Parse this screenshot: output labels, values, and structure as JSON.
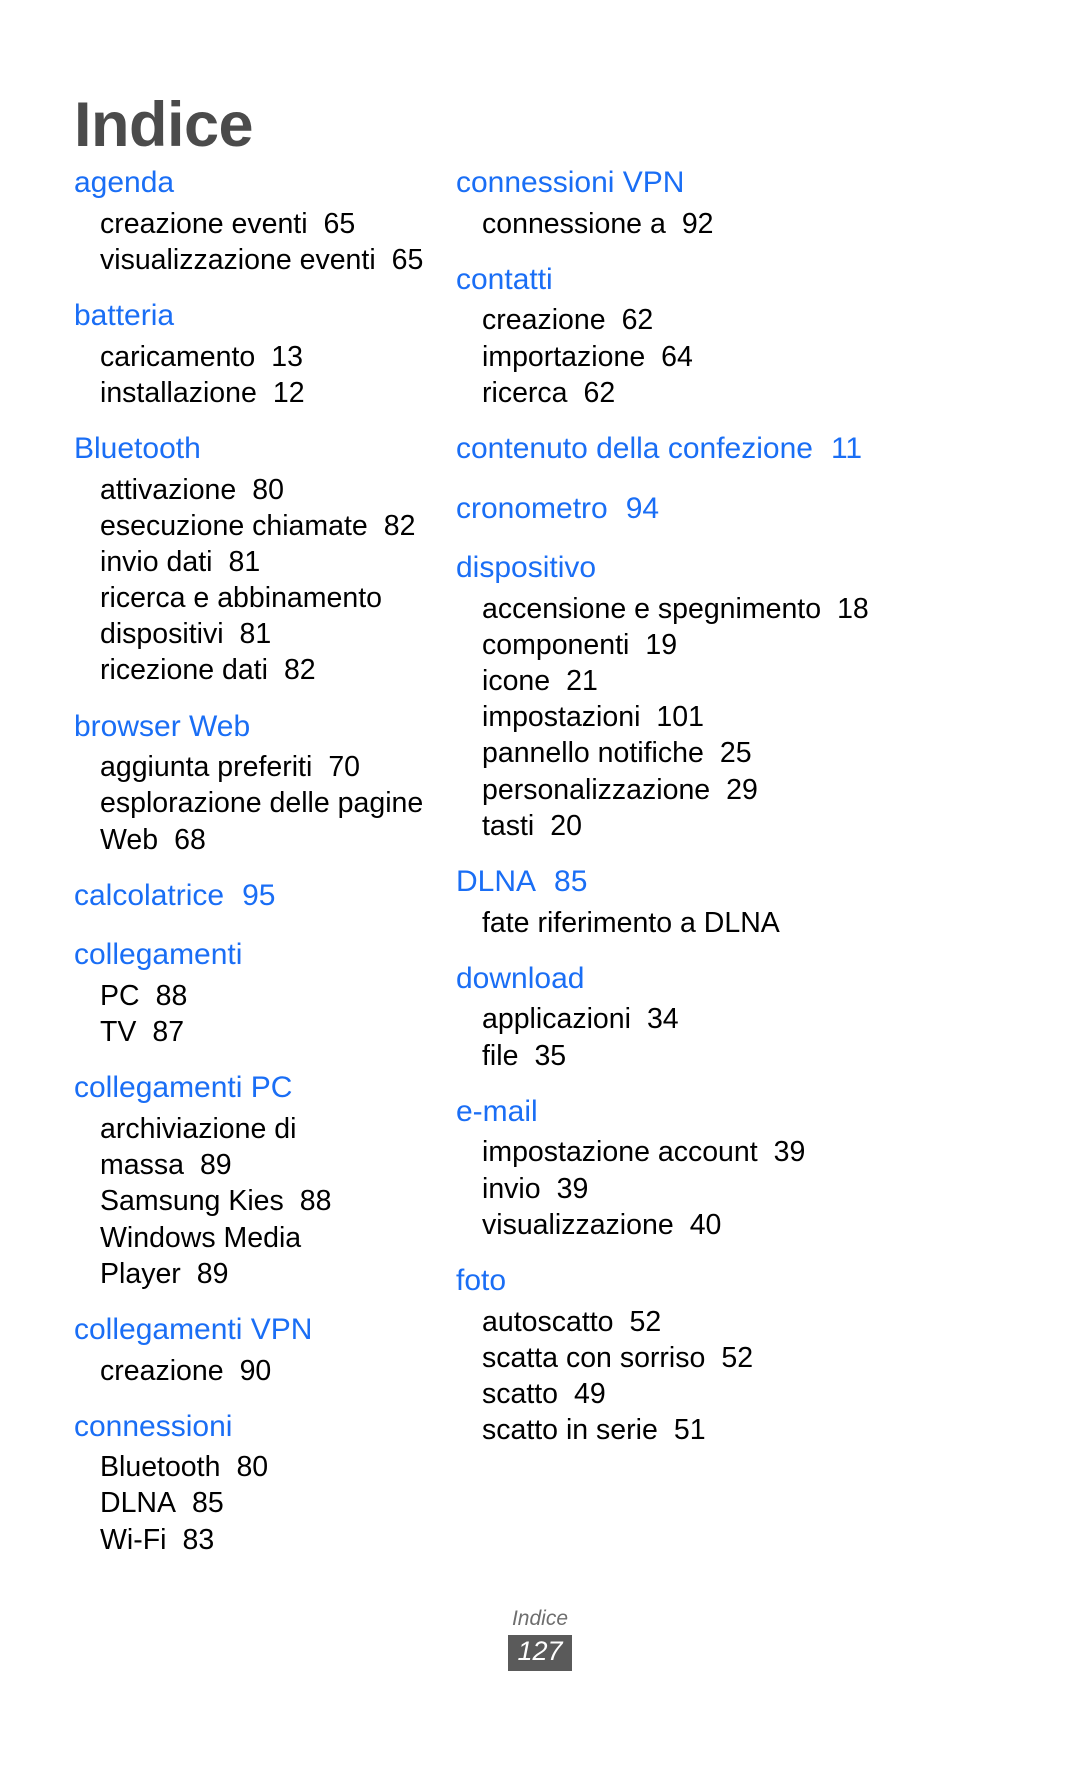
{
  "document": {
    "title": "Indice",
    "accent_color": "#1a6ef5",
    "title_color": "#4b4b4b"
  },
  "footer": {
    "label": "Indice",
    "page_number": "127"
  },
  "columns": [
    {
      "name": "left-column",
      "entries": [
        {
          "heading": "agenda",
          "heading_page": "",
          "subs": [
            {
              "label": "creazione eventi",
              "page": "65"
            },
            {
              "label": "visualizzazione eventi",
              "page": "65"
            }
          ]
        },
        {
          "heading": "batteria",
          "heading_page": "",
          "subs": [
            {
              "label": "caricamento",
              "page": "13"
            },
            {
              "label": "installazione",
              "page": "12"
            }
          ]
        },
        {
          "heading": "Bluetooth",
          "heading_page": "",
          "subs": [
            {
              "label": "attivazione",
              "page": "80"
            },
            {
              "label": "esecuzione chiamate",
              "page": "82"
            },
            {
              "label": "invio dati",
              "page": "81"
            },
            {
              "label": "ricerca e abbinamento dispositivi",
              "page": "81"
            },
            {
              "label": "ricezione dati",
              "page": "82"
            }
          ]
        },
        {
          "heading": "browser Web",
          "heading_page": "",
          "subs": [
            {
              "label": "aggiunta preferiti",
              "page": "70"
            },
            {
              "label": "esplorazione delle pagine Web",
              "page": "68"
            }
          ]
        },
        {
          "heading": "calcolatrice",
          "heading_page": "95",
          "subs": []
        },
        {
          "heading": "collegamenti",
          "heading_page": "",
          "subs": [
            {
              "label": "PC",
              "page": "88"
            },
            {
              "label": "TV",
              "page": "87"
            }
          ]
        },
        {
          "heading": "collegamenti PC",
          "heading_page": "",
          "subs": [
            {
              "label": "archiviazione di massa",
              "page": "89"
            },
            {
              "label": "Samsung Kies",
              "page": "88"
            },
            {
              "label": "Windows Media Player",
              "page": "89"
            }
          ]
        },
        {
          "heading": "collegamenti VPN",
          "heading_page": "",
          "subs": [
            {
              "label": "creazione",
              "page": "90"
            }
          ]
        },
        {
          "heading": "connessioni",
          "heading_page": "",
          "subs": [
            {
              "label": "Bluetooth",
              "page": "80"
            },
            {
              "label": "DLNA",
              "page": "85"
            },
            {
              "label": "Wi-Fi",
              "page": "83"
            }
          ]
        }
      ]
    },
    {
      "name": "right-column",
      "entries": [
        {
          "heading": "connessioni VPN",
          "heading_page": "",
          "subs": [
            {
              "label": "connessione a",
              "page": "92"
            }
          ]
        },
        {
          "heading": "contatti",
          "heading_page": "",
          "subs": [
            {
              "label": "creazione",
              "page": "62"
            },
            {
              "label": "importazione",
              "page": "64"
            },
            {
              "label": "ricerca",
              "page": "62"
            }
          ]
        },
        {
          "heading": "contenuto della confezione",
          "heading_page": "11",
          "subs": []
        },
        {
          "heading": "cronometro",
          "heading_page": "94",
          "subs": []
        },
        {
          "heading": "dispositivo",
          "heading_page": "",
          "subs": [
            {
              "label": "accensione e spegnimento",
              "page": "18"
            },
            {
              "label": "componenti",
              "page": "19"
            },
            {
              "label": "icone",
              "page": "21"
            },
            {
              "label": "impostazioni",
              "page": "101"
            },
            {
              "label": "pannello notifiche",
              "page": "25"
            },
            {
              "label": "personalizzazione",
              "page": "29"
            },
            {
              "label": "tasti",
              "page": "20"
            }
          ]
        },
        {
          "heading": "DLNA",
          "heading_page": "85",
          "subs": [
            {
              "label": "fate riferimento a DLNA",
              "page": ""
            }
          ]
        },
        {
          "heading": "download",
          "heading_page": "",
          "subs": [
            {
              "label": "applicazioni",
              "page": "34"
            },
            {
              "label": "file",
              "page": "35"
            }
          ]
        },
        {
          "heading": "e-mail",
          "heading_page": "",
          "subs": [
            {
              "label": "impostazione account",
              "page": "39"
            },
            {
              "label": "invio",
              "page": "39"
            },
            {
              "label": "visualizzazione",
              "page": "40"
            }
          ]
        },
        {
          "heading": "foto",
          "heading_page": "",
          "subs": [
            {
              "label": "autoscatto",
              "page": "52"
            },
            {
              "label": "scatta con sorriso",
              "page": "52"
            },
            {
              "label": "scatto",
              "page": "49"
            },
            {
              "label": "scatto in serie",
              "page": "51"
            }
          ]
        }
      ]
    }
  ]
}
